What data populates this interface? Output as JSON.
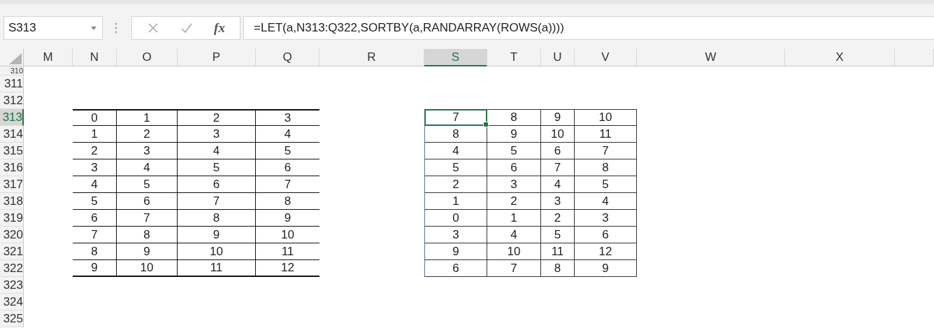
{
  "name_box": "S313",
  "formula_bar": {
    "function_label": "fx",
    "formula": "=LET(a,N313:Q322,SORTBY(a,RANDARRAY(ROWS(a))))"
  },
  "columns": [
    {
      "label": "M",
      "selected": false
    },
    {
      "label": "N",
      "selected": false
    },
    {
      "label": "O",
      "selected": false
    },
    {
      "label": "P",
      "selected": false
    },
    {
      "label": "Q",
      "selected": false
    },
    {
      "label": "R",
      "selected": false
    },
    {
      "label": "S",
      "selected": true
    },
    {
      "label": "T",
      "selected": false
    },
    {
      "label": "U",
      "selected": false
    },
    {
      "label": "V",
      "selected": false
    },
    {
      "label": "W",
      "selected": false
    },
    {
      "label": "X",
      "selected": false
    }
  ],
  "rows": [
    {
      "label": "310",
      "selected": false
    },
    {
      "label": "311",
      "selected": false
    },
    {
      "label": "312",
      "selected": false
    },
    {
      "label": "313",
      "selected": true
    },
    {
      "label": "314",
      "selected": false
    },
    {
      "label": "315",
      "selected": false
    },
    {
      "label": "316",
      "selected": false
    },
    {
      "label": "317",
      "selected": false
    },
    {
      "label": "318",
      "selected": false
    },
    {
      "label": "319",
      "selected": false
    },
    {
      "label": "320",
      "selected": false
    },
    {
      "label": "321",
      "selected": false
    },
    {
      "label": "322",
      "selected": false
    },
    {
      "label": "323",
      "selected": false
    },
    {
      "label": "324",
      "selected": false
    },
    {
      "label": "325",
      "selected": false
    }
  ],
  "source_table": [
    [
      "0",
      "1",
      "2",
      "3"
    ],
    [
      "1",
      "2",
      "3",
      "4"
    ],
    [
      "2",
      "3",
      "4",
      "5"
    ],
    [
      "3",
      "4",
      "5",
      "6"
    ],
    [
      "4",
      "5",
      "6",
      "7"
    ],
    [
      "5",
      "6",
      "7",
      "8"
    ],
    [
      "6",
      "7",
      "8",
      "9"
    ],
    [
      "7",
      "8",
      "9",
      "10"
    ],
    [
      "8",
      "9",
      "10",
      "11"
    ],
    [
      "9",
      "10",
      "11",
      "12"
    ]
  ],
  "sorted_table": [
    [
      {
        "value": "7",
        "selected": true
      },
      {
        "value": "8",
        "selected": false
      },
      {
        "value": "9",
        "selected": false
      },
      {
        "value": "10",
        "selected": false
      }
    ],
    [
      {
        "value": "8",
        "selected": false
      },
      {
        "value": "9",
        "selected": false
      },
      {
        "value": "10",
        "selected": false
      },
      {
        "value": "11",
        "selected": false
      }
    ],
    [
      {
        "value": "4",
        "selected": false
      },
      {
        "value": "5",
        "selected": false
      },
      {
        "value": "6",
        "selected": false
      },
      {
        "value": "7",
        "selected": false
      }
    ],
    [
      {
        "value": "5",
        "selected": false
      },
      {
        "value": "6",
        "selected": false
      },
      {
        "value": "7",
        "selected": false
      },
      {
        "value": "8",
        "selected": false
      }
    ],
    [
      {
        "value": "2",
        "selected": false
      },
      {
        "value": "3",
        "selected": false
      },
      {
        "value": "4",
        "selected": false
      },
      {
        "value": "5",
        "selected": false
      }
    ],
    [
      {
        "value": "1",
        "selected": false
      },
      {
        "value": "2",
        "selected": false
      },
      {
        "value": "3",
        "selected": false
      },
      {
        "value": "4",
        "selected": false
      }
    ],
    [
      {
        "value": "0",
        "selected": false
      },
      {
        "value": "1",
        "selected": false
      },
      {
        "value": "2",
        "selected": false
      },
      {
        "value": "3",
        "selected": false
      }
    ],
    [
      {
        "value": "3",
        "selected": false
      },
      {
        "value": "4",
        "selected": false
      },
      {
        "value": "5",
        "selected": false
      },
      {
        "value": "6",
        "selected": false
      }
    ],
    [
      {
        "value": "9",
        "selected": false
      },
      {
        "value": "10",
        "selected": false
      },
      {
        "value": "11",
        "selected": false
      },
      {
        "value": "12",
        "selected": false
      }
    ],
    [
      {
        "value": "6",
        "selected": false
      },
      {
        "value": "7",
        "selected": false
      },
      {
        "value": "8",
        "selected": false
      },
      {
        "value": "9",
        "selected": false
      }
    ]
  ]
}
